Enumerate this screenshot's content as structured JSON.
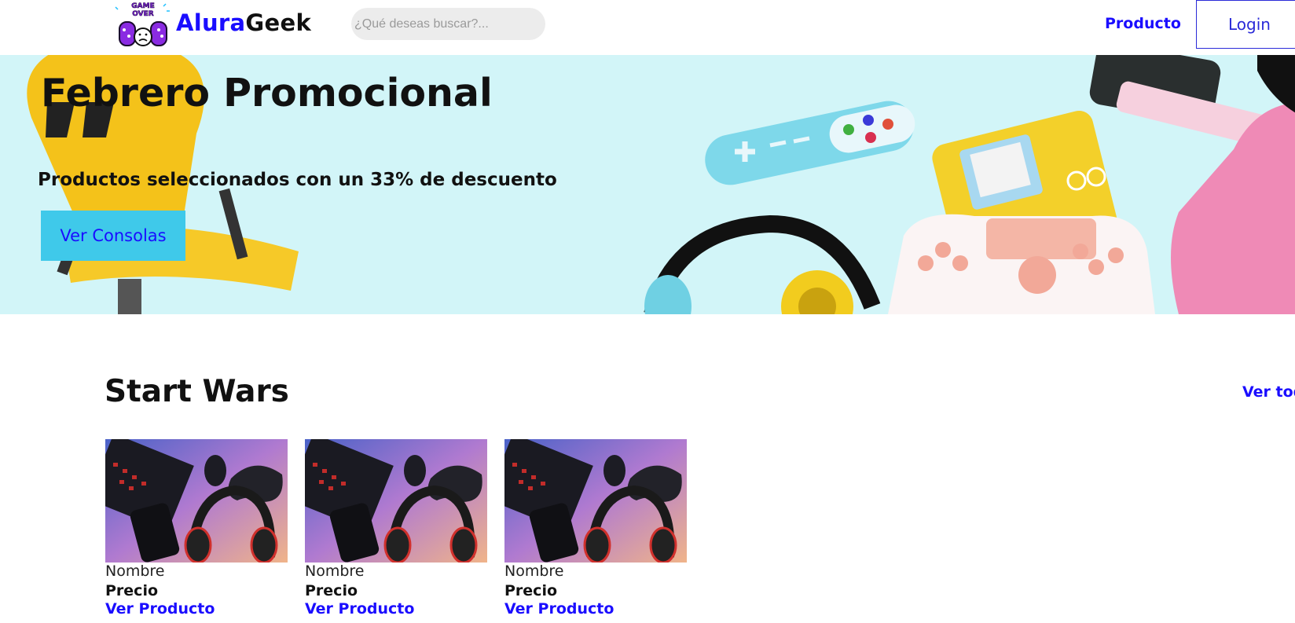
{
  "header": {
    "logo_badge_text": "GAME OVER",
    "logo_part1": "Alura",
    "logo_part2": "Geek",
    "search_placeholder": "¿Qué deseas buscar?...",
    "nav_producto": "Producto",
    "login_label": "Login"
  },
  "banner": {
    "title": "Febrero Promocional",
    "subtitle": "Productos seleccionados con un 33% de descuento",
    "button_label": "Ver Consolas"
  },
  "section": {
    "title": "Start Wars",
    "ver_todo": "Ver todo"
  },
  "products": [
    {
      "name": "Nombre",
      "price": "Precio",
      "link": "Ver Producto"
    },
    {
      "name": "Nombre",
      "price": "Precio",
      "link": "Ver Producto"
    },
    {
      "name": "Nombre",
      "price": "Precio",
      "link": "Ver Producto"
    }
  ],
  "colors": {
    "brand_blue": "#1a0dff",
    "banner_bg": "#d2f5f8",
    "button_cyan": "#3fc9ea"
  }
}
